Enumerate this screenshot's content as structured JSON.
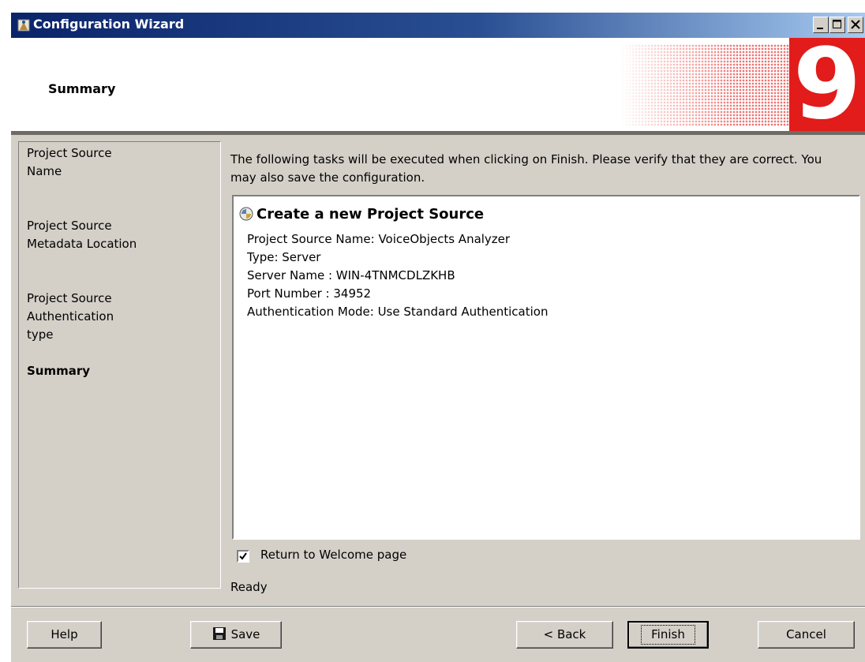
{
  "window": {
    "title": "Configuration Wizard",
    "icon": "wizard-app-icon",
    "controls": [
      "minimize-icon",
      "maximize-icon",
      "close-icon"
    ]
  },
  "header": {
    "title": "Summary",
    "brand_number": "9",
    "brand_color": "#e21b1b"
  },
  "sidebar": {
    "items": [
      {
        "label": "Project Source\nName"
      },
      {
        "label": "Project Source\nMetadata Location"
      },
      {
        "label": "Project Source\nAuthentication\ntype"
      },
      {
        "label": "Summary",
        "active": true
      }
    ]
  },
  "main": {
    "intro": "The following tasks will be executed when clicking on Finish. Please verify that they are correct. You may also save the configuration.",
    "task": {
      "icon": "project-source-icon",
      "title": "Create a new Project Source",
      "lines": [
        "Project Source Name: VoiceObjects Analyzer",
        "Type: Server",
        "Server Name : WIN-4TNMCDLZKHB",
        "Port Number : 34952",
        "Authentication Mode: Use Standard Authentication"
      ]
    },
    "return_checkbox": {
      "label": "Return to Welcome page",
      "checked": true
    },
    "status": "Ready"
  },
  "footer": {
    "help": "Help",
    "save": "Save",
    "back": "< Back",
    "finish": "Finish",
    "cancel": "Cancel"
  }
}
